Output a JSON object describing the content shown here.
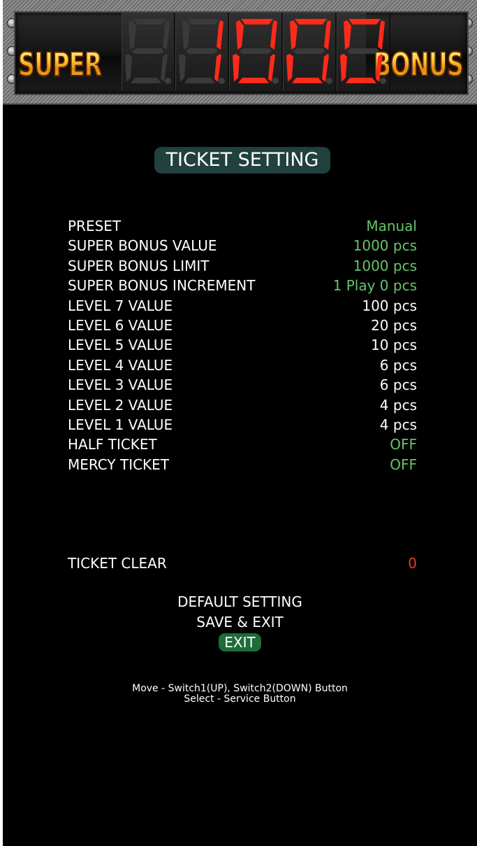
{
  "marquee": {
    "brand_left": "SUPER",
    "brand_right": "BONUS",
    "display_digits": [
      "",
      "1",
      "0",
      "0",
      "0"
    ]
  },
  "title": "TICKET SETTING",
  "settings": [
    {
      "label": "PRESET",
      "value": "Manual",
      "color": "green"
    },
    {
      "label": "SUPER BONUS VALUE",
      "value": "1000 pcs",
      "color": "green"
    },
    {
      "label": "SUPER BONUS LIMIT",
      "value": "1000 pcs",
      "color": "green"
    },
    {
      "label": "SUPER BONUS INCREMENT",
      "value": "1 Play 0 pcs",
      "color": "green"
    },
    {
      "label": "LEVEL 7 VALUE",
      "value": "100 pcs",
      "color": "white"
    },
    {
      "label": "LEVEL 6 VALUE",
      "value": "20 pcs",
      "color": "white"
    },
    {
      "label": "LEVEL 5 VALUE",
      "value": "10 pcs",
      "color": "white"
    },
    {
      "label": "LEVEL 4 VALUE",
      "value": "6 pcs",
      "color": "white"
    },
    {
      "label": "LEVEL 3 VALUE",
      "value": "6 pcs",
      "color": "white"
    },
    {
      "label": "LEVEL 2 VALUE",
      "value": "4 pcs",
      "color": "white"
    },
    {
      "label": "LEVEL 1 VALUE",
      "value": "4 pcs",
      "color": "white"
    },
    {
      "label": "HALF TICKET",
      "value": "OFF",
      "color": "green"
    },
    {
      "label": "MERCY TICKET",
      "value": "OFF",
      "color": "green"
    }
  ],
  "ticket_clear": {
    "label": "TICKET CLEAR",
    "value": "0",
    "color": "red"
  },
  "menu": {
    "default_setting": "DEFAULT SETTING",
    "save_exit": "SAVE & EXIT",
    "exit": "EXIT",
    "selected": "exit"
  },
  "help": {
    "line1": "Move - Switch1(UP), Switch2(DOWN) Button",
    "line2": "Select - Service Button"
  },
  "colors": {
    "background": "#000000",
    "value_green": "#66c468",
    "value_red": "#e23b2c",
    "title_pill": "#21413e",
    "selected_pill": "#1f6b3a",
    "digit_on": "#ff2a1a",
    "digit_off": "#3a3a3a",
    "brand_gold": "#f7c52a"
  }
}
